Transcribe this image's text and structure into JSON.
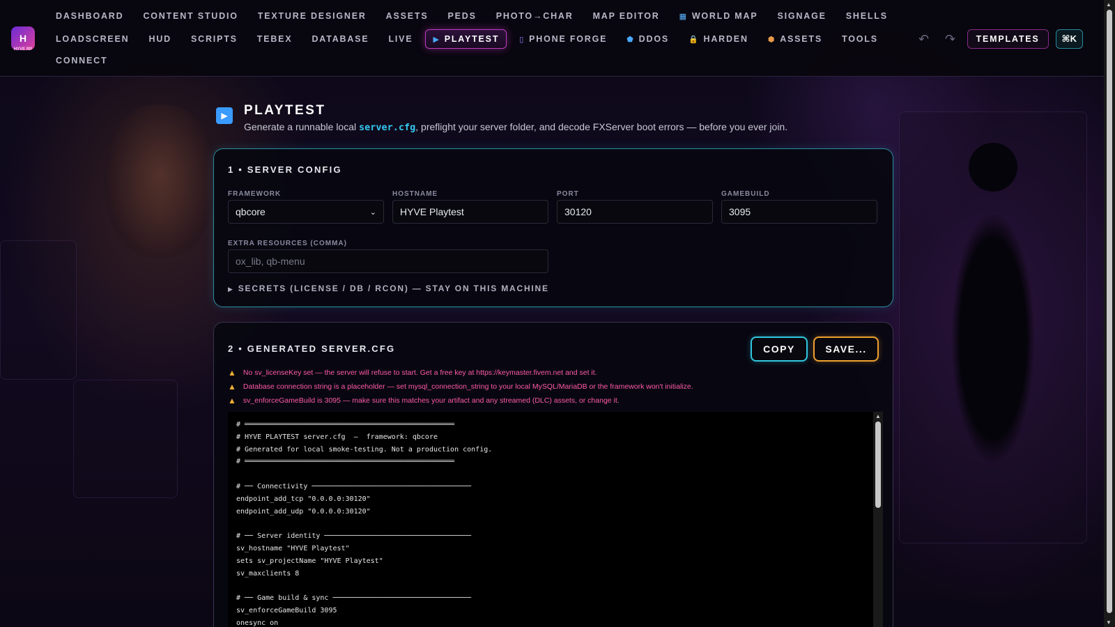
{
  "nav": {
    "row1": [
      {
        "label": "DASHBOARD",
        "icon": ""
      },
      {
        "label": "CONTENT STUDIO",
        "icon": ""
      },
      {
        "label": "TEXTURE DESIGNER",
        "icon": ""
      },
      {
        "label": "ASSETS",
        "icon": ""
      },
      {
        "label": "PEDS",
        "icon": ""
      },
      {
        "label": "PHOTO→CHAR",
        "icon": ""
      },
      {
        "label": "MAP EDITOR",
        "icon": ""
      },
      {
        "label": "WORLD MAP",
        "icon": "map-icon"
      },
      {
        "label": "SIGNAGE",
        "icon": ""
      },
      {
        "label": "SHELLS",
        "icon": ""
      }
    ],
    "row2": [
      {
        "label": "LOADSCREEN",
        "icon": ""
      },
      {
        "label": "HUD",
        "icon": ""
      },
      {
        "label": "SCRIPTS",
        "icon": ""
      },
      {
        "label": "TEBEX",
        "icon": ""
      },
      {
        "label": "DATABASE",
        "icon": ""
      },
      {
        "label": "LIVE",
        "icon": ""
      },
      {
        "label": "PLAYTEST",
        "icon": "play-icon",
        "active": true
      },
      {
        "label": "PHONE FORGE",
        "icon": "phone-icon"
      },
      {
        "label": "DDOS",
        "icon": "shield-icon"
      },
      {
        "label": "HARDEN",
        "icon": "lock-icon"
      },
      {
        "label": "ASSETS",
        "icon": "box-icon"
      },
      {
        "label": "TOOLS",
        "icon": ""
      }
    ],
    "row3": [
      {
        "label": "CONNECT",
        "icon": ""
      }
    ],
    "templates_label": "TEMPLATES",
    "cmdk_label": "⌘K"
  },
  "logo": {
    "text": "H",
    "sub": "HYVE RP"
  },
  "page": {
    "title": "PLAYTEST",
    "subtitle_pre": "Generate a runnable local ",
    "subtitle_code": "server.cfg",
    "subtitle_post": ", preflight your server folder, and decode FXServer boot errors — before you ever join."
  },
  "server_config": {
    "title": "1 • SERVER CONFIG",
    "framework_label": "FRAMEWORK",
    "framework_value": "qbcore",
    "hostname_label": "HOSTNAME",
    "hostname_value": "HYVE Playtest",
    "port_label": "PORT",
    "port_value": "30120",
    "gamebuild_label": "GAMEBUILD",
    "gamebuild_value": "3095",
    "extra_label": "EXTRA RESOURCES (COMMA)",
    "extra_placeholder": "ox_lib, qb-menu",
    "secrets_label": "SECRETS (LICENSE / DB / RCON) — STAY ON THIS MACHINE"
  },
  "generated": {
    "title": "2 • GENERATED SERVER.CFG",
    "copy_label": "COPY",
    "save_label": "SAVE...",
    "warnings": [
      "No sv_licenseKey set — the server will refuse to start. Get a free key at https://keymaster.fivem.net and set it.",
      "Database connection string is a placeholder — set mysql_connection_string to your local MySQL/MariaDB or the framework won't initialize.",
      "sv_enforceGameBuild is 3095 — make sure this matches your artifact and any streamed (DLC) assets, or change it."
    ],
    "code_lines": [
      "# ══════════════════════════════════════════════════",
      "# HYVE PLAYTEST server.cfg  —  framework: qbcore",
      "# Generated for local smoke-testing. Not a production config.",
      "# ══════════════════════════════════════════════════",
      "",
      "# ── Connectivity ──────────────────────────────────────",
      "endpoint_add_tcp \"0.0.0.0:30120\"",
      "endpoint_add_udp \"0.0.0.0:30120\"",
      "",
      "# ── Server identity ───────────────────────────────────",
      "sv_hostname \"HYVE Playtest\"",
      "sets sv_projectName \"HYVE Playtest\"",
      "sv_maxclients 8",
      "",
      "# ── Game build & sync ─────────────────────────────────",
      "sv_enforceGameBuild 3095",
      "onesync on"
    ]
  },
  "colors": {
    "accent_cyan": "#30c8e0",
    "accent_orange": "#f0a030",
    "accent_magenta": "#c03cc0",
    "warning_text": "#ff5aa8"
  }
}
